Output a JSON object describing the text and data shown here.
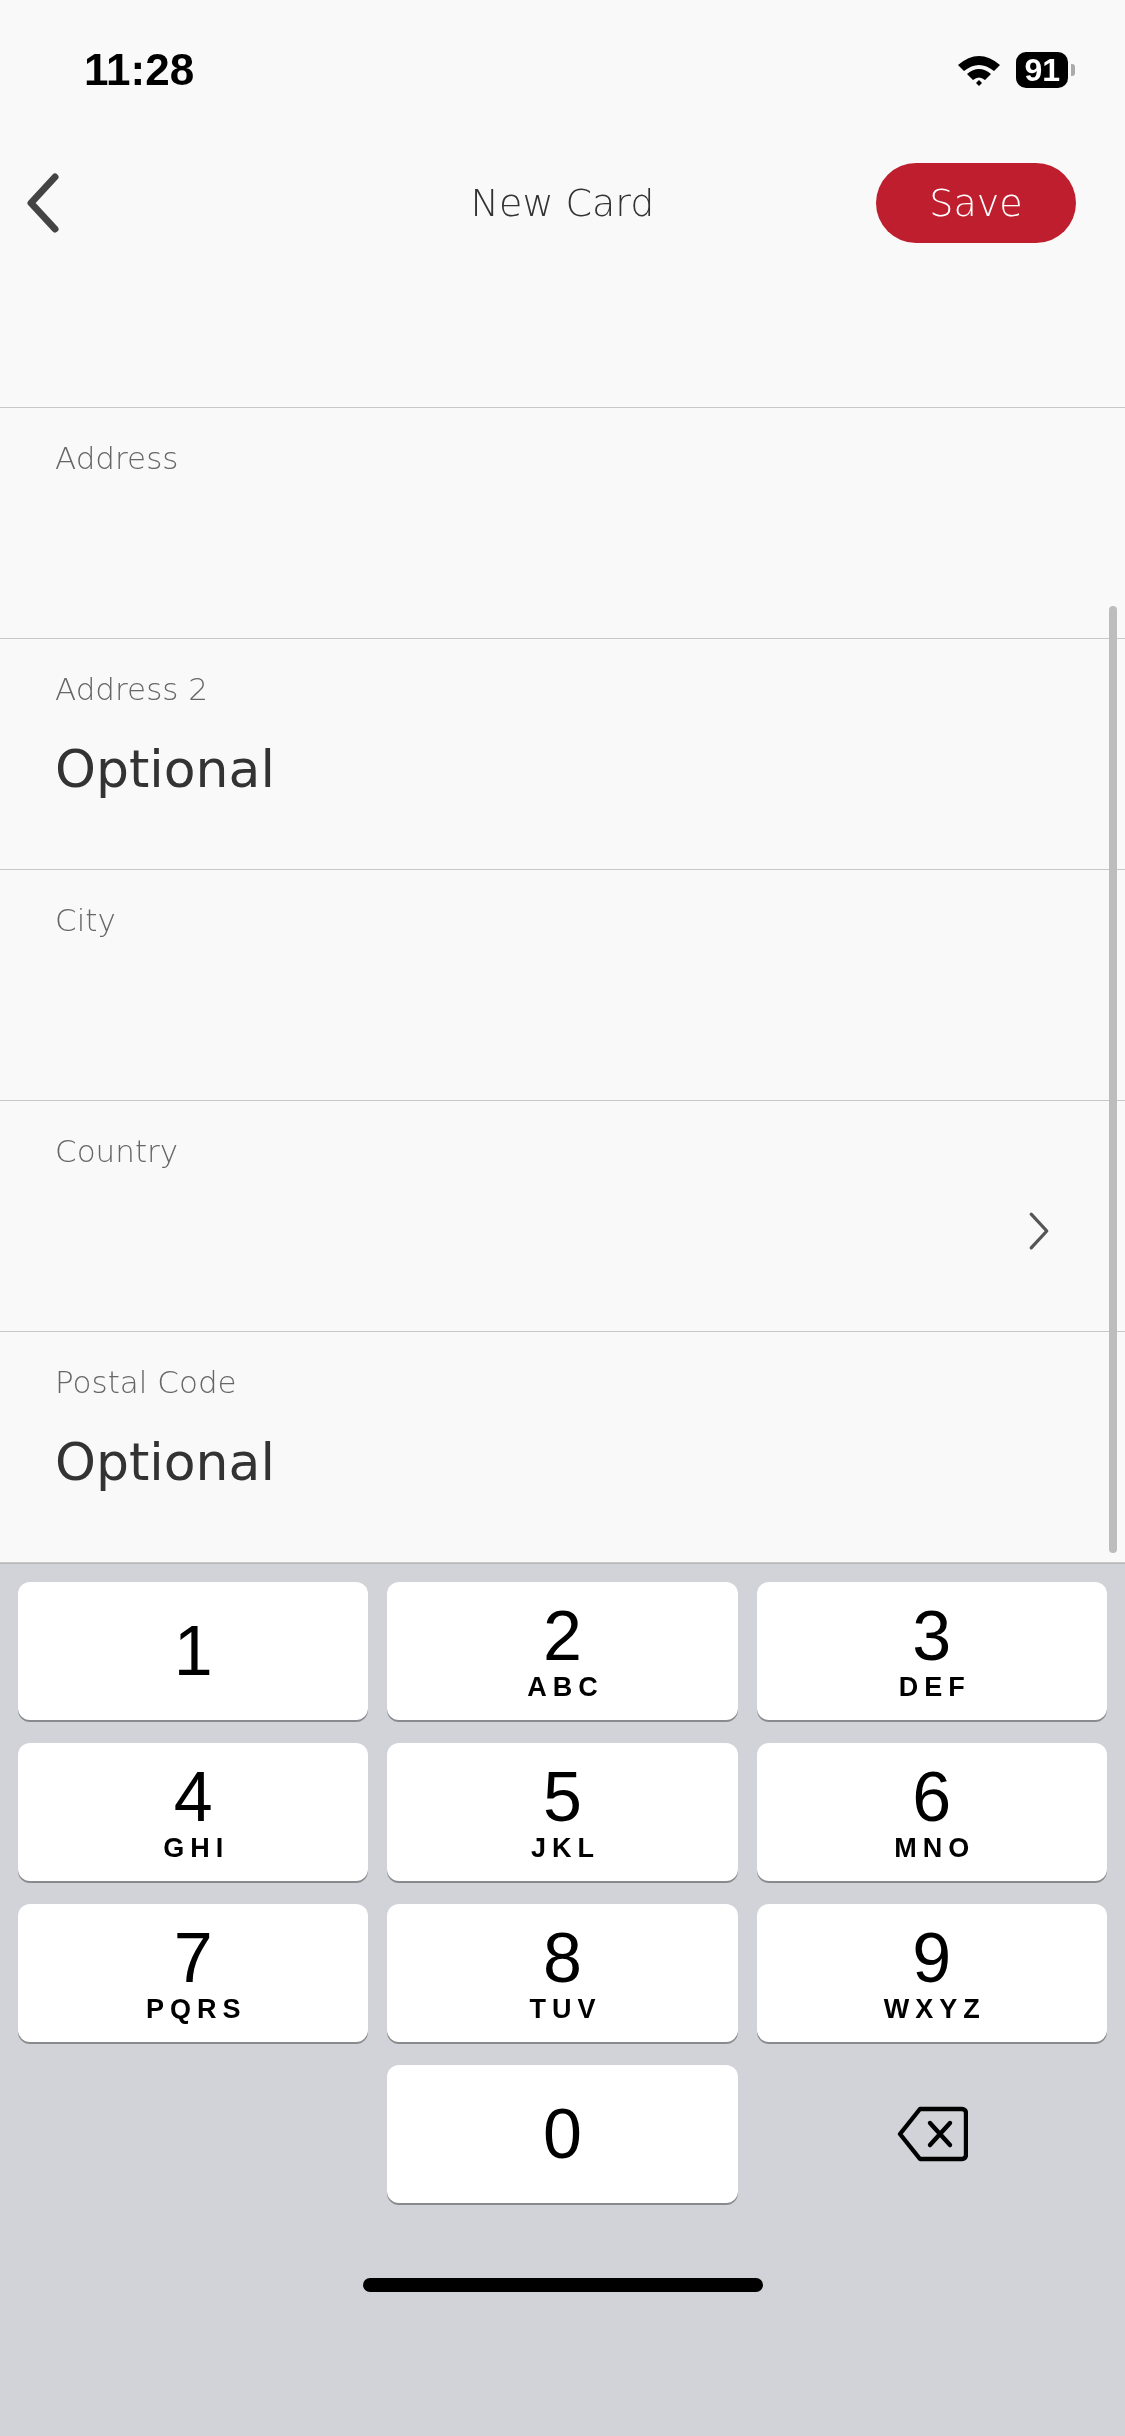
{
  "status_bar": {
    "time": "11:28",
    "battery": "91"
  },
  "header": {
    "title": "New Card",
    "save_button": "Save"
  },
  "fields": [
    {
      "label": "Address",
      "kind": "text"
    },
    {
      "label": "Address 2",
      "kind": "text",
      "placeholder": "Optional"
    },
    {
      "label": "City",
      "kind": "text"
    },
    {
      "label": "Country",
      "kind": "picker"
    },
    {
      "label": "Postal Code",
      "kind": "text",
      "placeholder": "Optional"
    }
  ],
  "keypad": [
    [
      {
        "kind": "digit",
        "digit": "1"
      },
      {
        "kind": "digit",
        "digit": "2",
        "letters": "ABC"
      },
      {
        "kind": "digit",
        "digit": "3",
        "letters": "DEF"
      }
    ],
    [
      {
        "kind": "digit",
        "digit": "4",
        "letters": "GHI"
      },
      {
        "kind": "digit",
        "digit": "5",
        "letters": "JKL"
      },
      {
        "kind": "digit",
        "digit": "6",
        "letters": "MNO"
      }
    ],
    [
      {
        "kind": "digit",
        "digit": "7",
        "letters": "PQRS"
      },
      {
        "kind": "digit",
        "digit": "8",
        "letters": "TUV"
      },
      {
        "kind": "digit",
        "digit": "9",
        "letters": "WXYZ"
      }
    ],
    [
      {
        "kind": "blank"
      },
      {
        "kind": "digit",
        "digit": "0"
      },
      {
        "kind": "delete"
      }
    ]
  ]
}
